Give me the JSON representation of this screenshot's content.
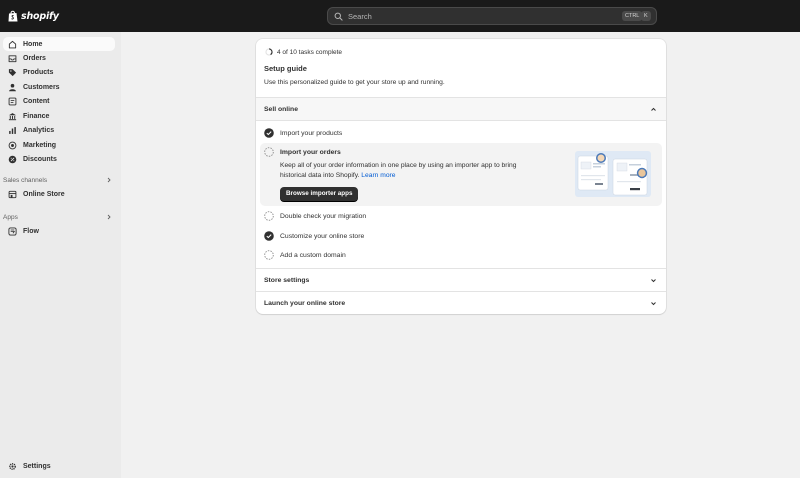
{
  "topbar": {
    "brand": "shopify",
    "search_placeholder": "Search",
    "shortcut_keys": [
      "CTRL",
      "K"
    ]
  },
  "sidebar": {
    "items": [
      {
        "label": "Home",
        "icon": "home-icon",
        "active": true
      },
      {
        "label": "Orders",
        "icon": "orders-icon"
      },
      {
        "label": "Products",
        "icon": "tag-icon"
      },
      {
        "label": "Customers",
        "icon": "person-icon"
      },
      {
        "label": "Content",
        "icon": "content-icon"
      },
      {
        "label": "Finance",
        "icon": "bank-icon"
      },
      {
        "label": "Analytics",
        "icon": "bar-chart-icon"
      },
      {
        "label": "Marketing",
        "icon": "target-icon"
      },
      {
        "label": "Discounts",
        "icon": "discount-icon"
      }
    ],
    "sales_channels": {
      "label": "Sales channels",
      "items": [
        {
          "label": "Online Store",
          "icon": "store-icon"
        }
      ]
    },
    "apps": {
      "label": "Apps",
      "items": [
        {
          "label": "Flow",
          "icon": "flow-icon"
        }
      ]
    },
    "settings": {
      "label": "Settings",
      "icon": "gear-icon"
    }
  },
  "setup_guide": {
    "progress_text": "4 of 10 tasks complete",
    "progress": 0.4,
    "title": "Setup guide",
    "subtitle": "Use this personalized guide to get your store up and running.",
    "sections": [
      {
        "title": "Sell online",
        "expanded": true,
        "tasks": [
          {
            "label": "Import your products",
            "done": true
          },
          {
            "label": "Import your orders",
            "done": false,
            "expanded": true,
            "description": "Keep all of your order information in one place by using an importer app to bring historical data into Shopify.",
            "link": "Learn more",
            "button": "Browse importer apps"
          },
          {
            "label": "Double check your migration",
            "done": false
          },
          {
            "label": "Customize your online store",
            "done": true
          },
          {
            "label": "Add a custom domain",
            "done": false
          }
        ]
      },
      {
        "title": "Store settings",
        "expanded": false
      },
      {
        "title": "Launch your online store",
        "expanded": false
      }
    ]
  },
  "colors": {
    "topbar": "#1a1a1a",
    "canvas": "#f1f1f1",
    "sidebar": "#ebebeb",
    "link": "#005bd3",
    "primary_button": "#303030"
  }
}
